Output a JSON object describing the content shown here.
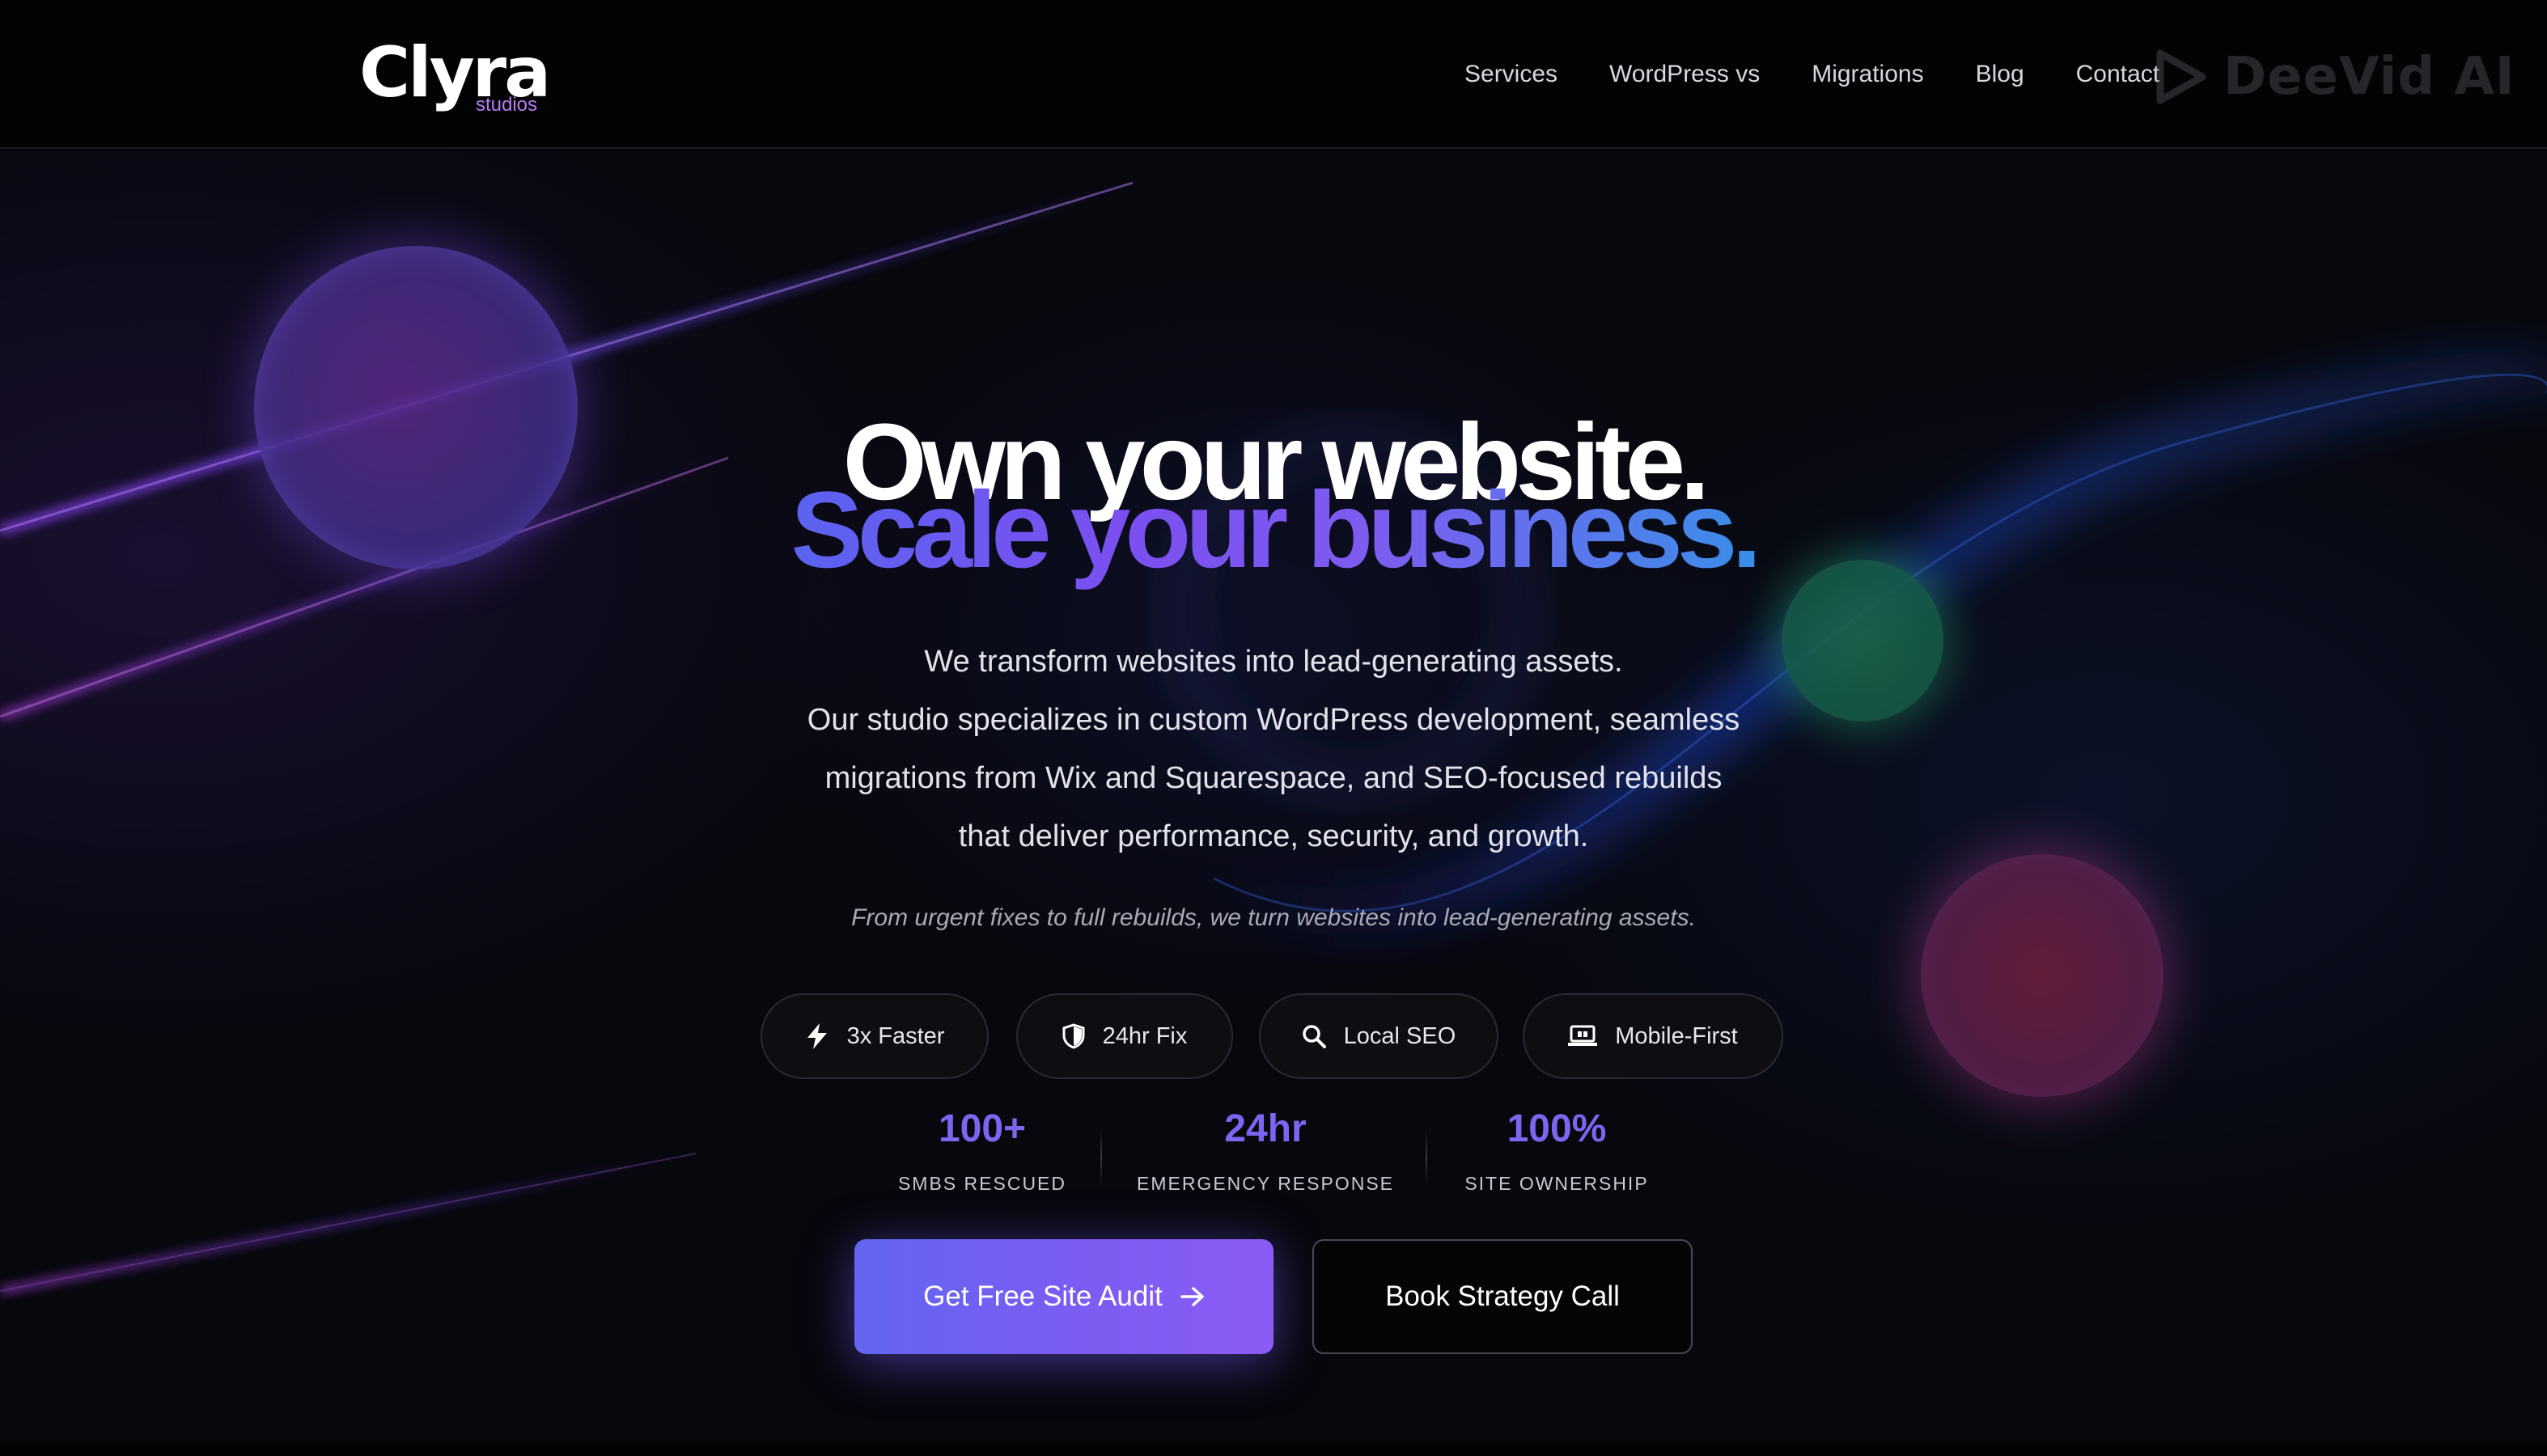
{
  "brand": {
    "name": "Clyra",
    "sub": "studios",
    "accent": "#b57cf2"
  },
  "nav": {
    "items": [
      {
        "label": "Services"
      },
      {
        "label": "WordPress vs"
      },
      {
        "label": "Migrations"
      },
      {
        "label": "Blog"
      },
      {
        "label": "Contact"
      }
    ]
  },
  "watermark": {
    "text": "DeeVid AI",
    "icon": "play-triangle-icon"
  },
  "hero": {
    "headline": "Own your website.",
    "headline_accent": "Scale your business.",
    "intro_lines": [
      "We transform websites into lead-generating assets.",
      "Our studio specializes in custom WordPress development, seamless",
      "migrations from Wix and Squarespace, and SEO-focused rebuilds",
      "that deliver performance, security, and growth."
    ],
    "tagline": "From urgent fixes to full rebuilds, we turn websites into lead-generating assets.",
    "pills": [
      {
        "label": "3x Faster",
        "icon": "lightning-icon"
      },
      {
        "label": "24hr Fix",
        "icon": "shield-icon"
      },
      {
        "label": "Local SEO",
        "icon": "search-icon"
      },
      {
        "label": "Mobile-First",
        "icon": "device-icon"
      }
    ],
    "stats": [
      {
        "value": "100+",
        "label": "SMBS RESCUED"
      },
      {
        "value": "24hr",
        "label": "EMERGENCY RESPONSE"
      },
      {
        "value": "100%",
        "label": "SITE OWNERSHIP"
      }
    ],
    "cta_primary": {
      "label": "Get Free Site Audit",
      "icon": "arrow-right-icon"
    },
    "cta_secondary": {
      "label": "Book Strategy Call"
    }
  },
  "colors": {
    "background": "#07070d",
    "stat_accent": "#7c65f0",
    "primary_button": "#6366f1"
  }
}
